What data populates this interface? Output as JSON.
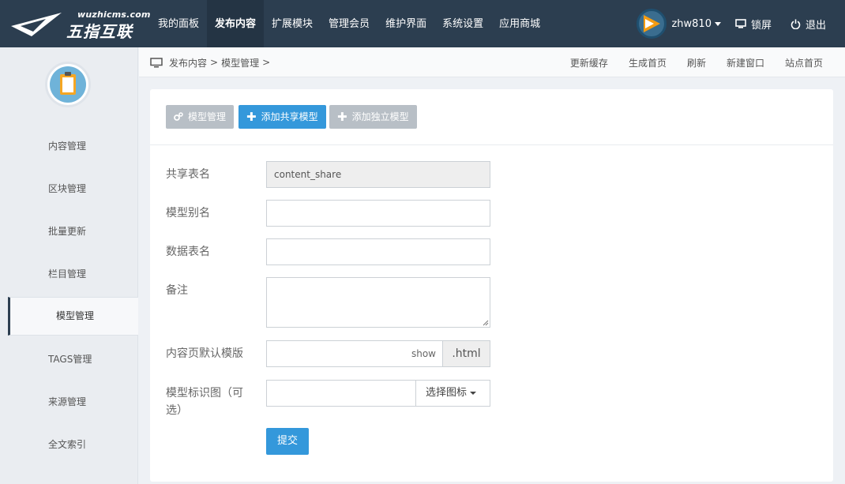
{
  "brand": {
    "url": "wuzhicms.com",
    "name": "五指互联"
  },
  "nav": {
    "items": [
      {
        "label": "我的面板"
      },
      {
        "label": "发布内容"
      },
      {
        "label": "扩展模块"
      },
      {
        "label": "管理会员"
      },
      {
        "label": "维护界面"
      },
      {
        "label": "系统设置"
      },
      {
        "label": "应用商城"
      }
    ],
    "active": "发布内容"
  },
  "user": {
    "name": "zhw810",
    "lock_label": "锁屏",
    "logout_label": "退出"
  },
  "sidebar": {
    "items": [
      {
        "label": "内容管理"
      },
      {
        "label": "区块管理"
      },
      {
        "label": "批量更新"
      },
      {
        "label": "栏目管理"
      },
      {
        "label": "模型管理"
      },
      {
        "label": "TAGS管理"
      },
      {
        "label": "来源管理"
      },
      {
        "label": "全文索引"
      }
    ],
    "active": "模型管理"
  },
  "breadcrumb": {
    "items": [
      "发布内容",
      "模型管理"
    ],
    "separator": ">"
  },
  "actions": [
    "更新缓存",
    "生成首页",
    "刷新",
    "新建窗口",
    "站点首页"
  ],
  "toolbar": {
    "model_manage": "模型管理",
    "add_shared": "添加共享模型",
    "add_independent": "添加独立模型"
  },
  "form": {
    "shared_table_label": "共享表名",
    "shared_table_value": "content_share",
    "alias_label": "模型别名",
    "alias_value": "",
    "table_name_label": "数据表名",
    "table_name_value": "",
    "remark_label": "备注",
    "remark_value": "",
    "template_label": "内容页默认模版",
    "template_value": "show",
    "template_suffix": ".html",
    "icon_label": "模型标识图（可选）",
    "icon_value": "",
    "icon_select_label": "选择图标",
    "submit_label": "提交"
  },
  "colors": {
    "topbar": "#2c3e50",
    "primary": "#3498db",
    "gray_button": "#b8bfc6"
  }
}
